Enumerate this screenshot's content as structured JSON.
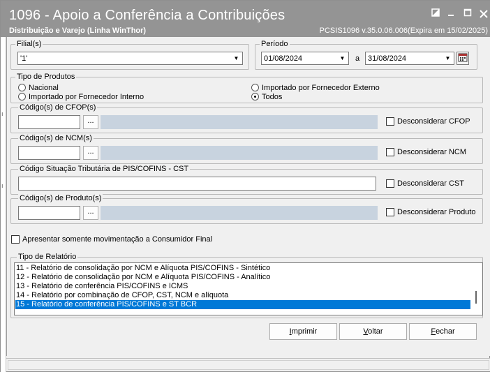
{
  "window": {
    "title": "1096 - Apoio a Conferência a Contribuições",
    "subtitle": "Distribuição e Varejo (Linha WinThor)",
    "version": "PCSIS1096  v.35.0.06.006(Expira em 15/02/2025)"
  },
  "filial": {
    "label": "Filial(s)",
    "value": "'1'"
  },
  "periodo": {
    "label": "Período",
    "start": "01/08/2024",
    "separator": "a",
    "end": "31/08/2024"
  },
  "tipo_produtos": {
    "label": "Tipo de Produtos",
    "options": [
      "Nacional",
      "Importado por Fornecedor Interno",
      "Importado por Fornecedor Externo",
      "Todos"
    ],
    "selected": "Todos"
  },
  "cfop": {
    "label": "Código(s) de CFOP(s)",
    "button": "...",
    "check_label": "Desconsiderar CFOP"
  },
  "ncm": {
    "label": "Código(s) de NCM(s)",
    "button": "...",
    "check_label": "Desconsiderar NCM"
  },
  "cst": {
    "label": "Código Situação Tributária de PIS/COFINS - CST",
    "check_label": "Desconsiderar CST"
  },
  "produto": {
    "label": "Código(s) de Produto(s)",
    "button": "...",
    "check_label": "Desconsiderar Produto"
  },
  "consumidor_final": {
    "label": "Apresentar somente movimentação a Consumidor Final"
  },
  "tipo_relatorio": {
    "label": "Tipo de Relatório",
    "items": [
      "11 - Relatório de consolidação por NCM e Alíquota PIS/COFINS - Sintético",
      "12 - Relatório de consolidação por NCM e Alíquota PIS/COFINS - Analítico",
      "13 - Relatório de conferência PIS/COFINS e ICMS",
      "14 - Relatório por combinação de CFOP, CST, NCM e alíquota",
      "15 - Relatório de conferência PIS/COFINS e ST BCR"
    ],
    "selected_index": 4
  },
  "buttons": {
    "imprimir": {
      "accel": "I",
      "rest": "mprimir"
    },
    "voltar": {
      "accel": "V",
      "rest": "oltar"
    },
    "fechar": {
      "accel": "F",
      "rest": "echar"
    }
  },
  "colors": {
    "titlebar": "#949494",
    "selection": "#0078d7",
    "disabled_field": "#c8d3df"
  }
}
